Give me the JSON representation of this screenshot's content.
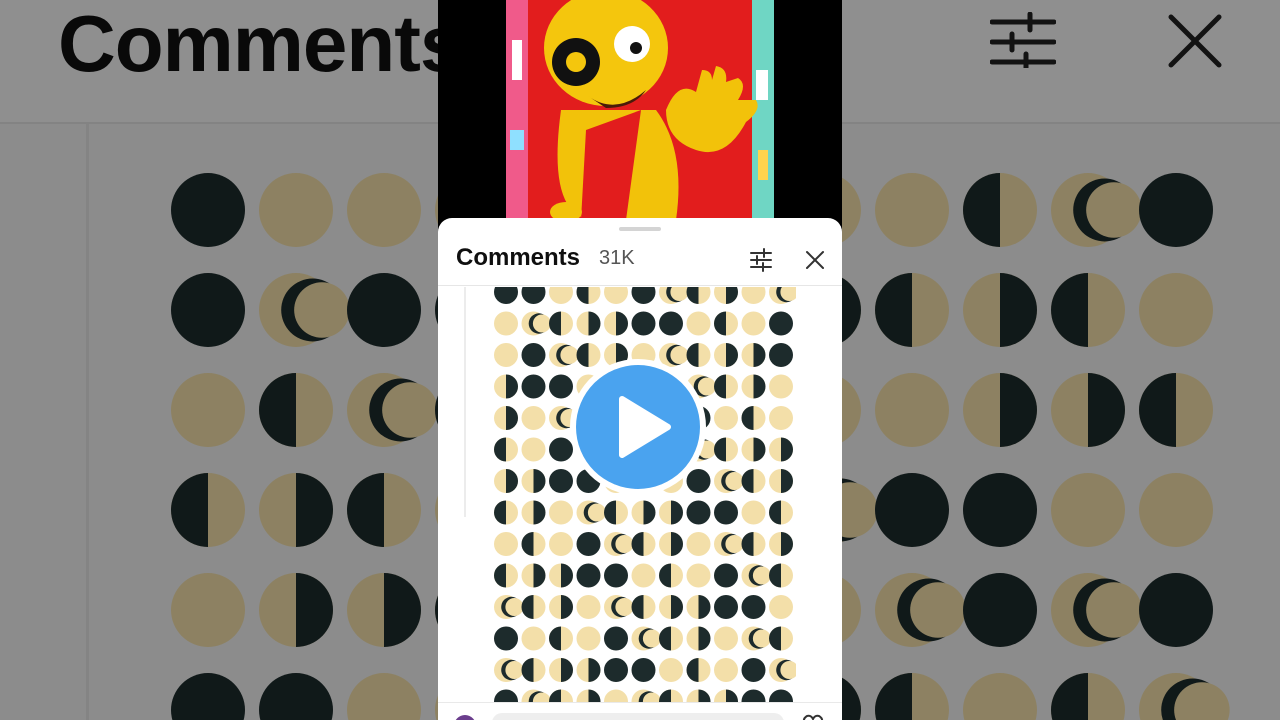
{
  "background": {
    "title": "Comments"
  },
  "sheet": {
    "title": "Comments",
    "count": "31K",
    "filter_icon": "sliders-icon",
    "close_icon": "close-icon"
  },
  "player": {
    "play_icon": "play-icon"
  },
  "colors": {
    "play_blue": "#4aa3ef",
    "moon_dark": "#1d2b2c",
    "moon_light": "#f3dfa9",
    "video_red": "#e21d1d",
    "emoji_yellow": "#f2c20a"
  }
}
